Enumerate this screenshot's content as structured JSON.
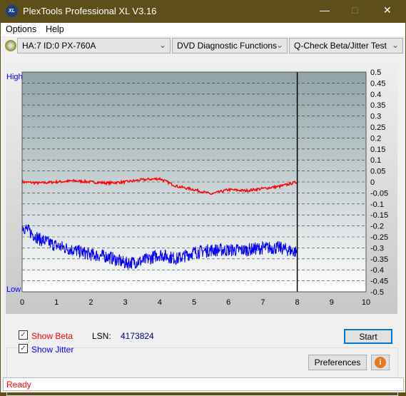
{
  "window": {
    "title": "PlexTools Professional XL V3.16",
    "logo_text": "XL"
  },
  "menu": [
    "Options",
    "Help"
  ],
  "toolbar": {
    "drive": "HA:7 ID:0  PX-760A",
    "function": "DVD Diagnostic Functions",
    "test": "Q-Check Beta/Jitter Test"
  },
  "controls": {
    "show_beta": "Show Beta",
    "show_jitter": "Show Jitter",
    "show_beta_checked": true,
    "show_jitter_checked": true,
    "lsn_label": "LSN:",
    "lsn_value": "4173824",
    "start": "Start",
    "preferences": "Preferences"
  },
  "status": "Ready",
  "chart_data": {
    "type": "line",
    "left_labels": {
      "top": "High",
      "bottom": "Low"
    },
    "xlim": [
      0,
      10
    ],
    "ylim": [
      -0.5,
      0.5
    ],
    "x_ticks": [
      "0",
      "1",
      "2",
      "3",
      "4",
      "5",
      "6",
      "7",
      "8",
      "9",
      "10"
    ],
    "y_ticks": [
      "0.5",
      "0.45",
      "0.4",
      "0.35",
      "0.3",
      "0.25",
      "0.2",
      "0.15",
      "0.1",
      "0.05",
      "0",
      "-0.05",
      "-0.1",
      "-0.15",
      "-0.2",
      "-0.25",
      "-0.3",
      "-0.35",
      "-0.4",
      "-0.45",
      "-0.5"
    ],
    "grid": true,
    "marker_x": 8,
    "x": [
      0,
      0.5,
      1,
      1.5,
      2,
      2.5,
      3,
      3.5,
      4,
      4.5,
      5,
      5.5,
      6,
      6.5,
      7,
      7.5,
      8
    ],
    "series": [
      {
        "name": "Beta",
        "color": "#ff0000",
        "values": [
          0,
          -0.005,
          0,
          0.005,
          0,
          -0.005,
          0,
          0.01,
          0.015,
          -0.02,
          -0.035,
          -0.055,
          -0.035,
          -0.04,
          -0.03,
          -0.02,
          0
        ]
      },
      {
        "name": "Jitter",
        "color": "#0000ff",
        "values": [
          -0.2,
          -0.26,
          -0.29,
          -0.31,
          -0.33,
          -0.34,
          -0.37,
          -0.36,
          -0.33,
          -0.35,
          -0.32,
          -0.31,
          -0.31,
          -0.31,
          -0.3,
          -0.3,
          -0.32
        ]
      }
    ]
  }
}
